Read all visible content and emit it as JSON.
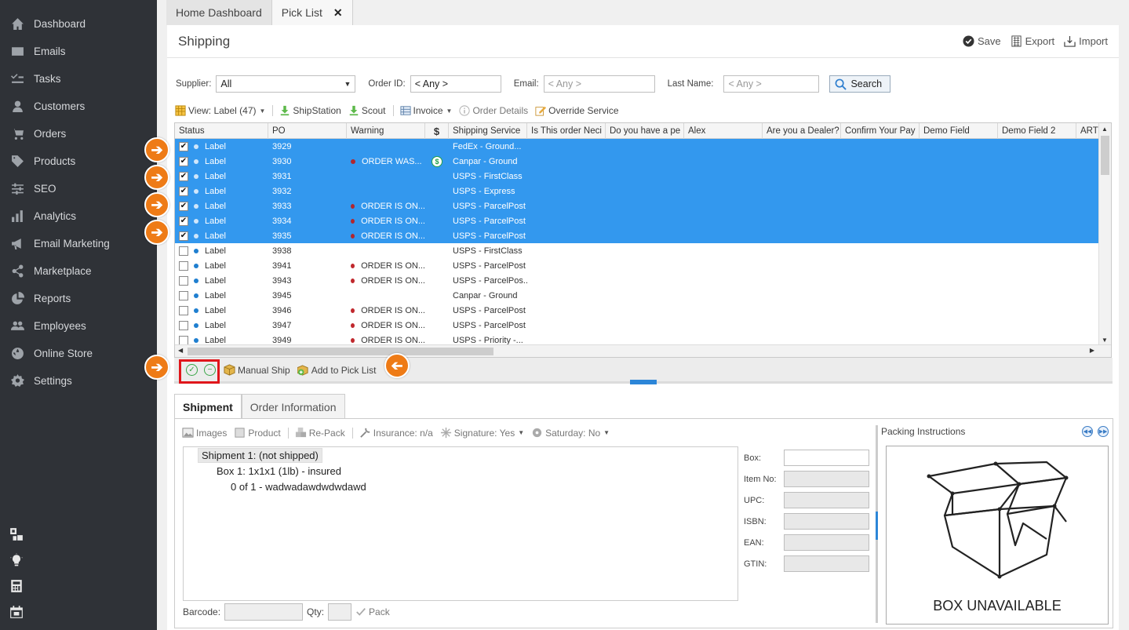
{
  "sidebar": {
    "items": [
      {
        "label": "Dashboard",
        "icon": "home-icon"
      },
      {
        "label": "Emails",
        "icon": "mail-icon"
      },
      {
        "label": "Tasks",
        "icon": "tasks-icon"
      },
      {
        "label": "Customers",
        "icon": "user-icon"
      },
      {
        "label": "Orders",
        "icon": "cart-icon"
      },
      {
        "label": "Products",
        "icon": "tag-icon"
      },
      {
        "label": "SEO",
        "icon": "sliders-icon"
      },
      {
        "label": "Analytics",
        "icon": "bar-chart-icon"
      },
      {
        "label": "Email Marketing",
        "icon": "megaphone-icon"
      },
      {
        "label": "Marketplace",
        "icon": "share-icon"
      },
      {
        "label": "Reports",
        "icon": "pie-chart-icon"
      },
      {
        "label": "Employees",
        "icon": "users-icon"
      },
      {
        "label": "Online Store",
        "icon": "globe-icon"
      },
      {
        "label": "Settings",
        "icon": "settings-icon"
      }
    ]
  },
  "tabs": [
    {
      "label": "Home Dashboard"
    },
    {
      "label": "Pick List",
      "close": "✕"
    }
  ],
  "header": {
    "title": "Shipping",
    "save": "Save",
    "export": "Export",
    "import": "Import"
  },
  "filters": {
    "supplier_label": "Supplier:",
    "supplier_value": "All",
    "orderid_label": "Order ID:",
    "orderid_value": "< Any >",
    "email_label": "Email:",
    "email_value": "< Any >",
    "lastname_label": "Last Name:",
    "lastname_value": "< Any >",
    "search": "Search"
  },
  "toolbar": {
    "view": "View: Label (47)",
    "shipstation": "ShipStation",
    "scout": "Scout",
    "invoice": "Invoice",
    "order_details": "Order Details",
    "override": "Override Service"
  },
  "grid": {
    "columns": [
      "Status",
      "PO",
      "Warning",
      "$",
      "Shipping Service",
      "Is This order Neci",
      "Do you have a pe",
      "Alex",
      "Are you a Dealer?",
      "Confirm Your Pay",
      "Demo Field",
      "Demo Field 2",
      "ARTH"
    ],
    "rows": [
      {
        "checked": "✔",
        "status": "Label",
        "po": "3929",
        "warning": "",
        "service": "FedEx - Ground..."
      },
      {
        "checked": "✔",
        "status": "Label",
        "po": "3930",
        "warning": "ORDER WAS...",
        "money": "$",
        "service": "Canpar - Ground"
      },
      {
        "checked": "✔",
        "status": "Label",
        "po": "3931",
        "warning": "",
        "service": "USPS - FirstClass"
      },
      {
        "checked": "✔",
        "status": "Label",
        "po": "3932",
        "warning": "",
        "service": "USPS - Express"
      },
      {
        "checked": "✔",
        "status": "Label",
        "po": "3933",
        "warning": "ORDER IS ON...",
        "service": "USPS - ParcelPost"
      },
      {
        "checked": "✔",
        "status": "Label",
        "po": "3934",
        "warning": "ORDER IS ON...",
        "service": "USPS - ParcelPost"
      },
      {
        "checked": "✔",
        "status": "Label",
        "po": "3935",
        "warning": "ORDER IS ON...",
        "service": "USPS - ParcelPost"
      },
      {
        "checked": "",
        "status": "Label",
        "po": "3938",
        "warning": "",
        "service": "USPS - FirstClass"
      },
      {
        "checked": "",
        "status": "Label",
        "po": "3941",
        "warning": "ORDER IS ON...",
        "service": "USPS - ParcelPost"
      },
      {
        "checked": "",
        "status": "Label",
        "po": "3943",
        "warning": "ORDER IS ON...",
        "service": "USPS - ParcelPos..."
      },
      {
        "checked": "",
        "status": "Label",
        "po": "3945",
        "warning": "",
        "service": "Canpar - Ground"
      },
      {
        "checked": "",
        "status": "Label",
        "po": "3946",
        "warning": "ORDER IS ON...",
        "service": "USPS - ParcelPost"
      },
      {
        "checked": "",
        "status": "Label",
        "po": "3947",
        "warning": "ORDER IS ON...",
        "service": "USPS - ParcelPost"
      },
      {
        "checked": "",
        "status": "Label",
        "po": "3949",
        "warning": "ORDER IS ON...",
        "service": "USPS - Priority -..."
      }
    ]
  },
  "bottom_bar": {
    "select_all": "✓",
    "deselect_all": "−",
    "manual_ship": "Manual Ship",
    "add_pick_list": "Add to Pick List"
  },
  "callouts": {
    "right": "➔",
    "left": "➔"
  },
  "shipment": {
    "tabs": [
      "Shipment",
      "Order Information"
    ],
    "toolbar": {
      "images": "Images",
      "product": "Product",
      "repack": "Re-Pack",
      "insurance": "Insurance: n/a",
      "signature": "Signature: Yes",
      "saturday": "Saturday: No"
    },
    "tree": {
      "shipment": "Shipment 1: (not shipped)",
      "box": "Box 1: 1x1x1 (1lb) - insured",
      "item": "0 of 1 - wadwadawdwdwdawd"
    },
    "fields": [
      "Box:",
      "Item No:",
      "UPC:",
      "ISBN:",
      "EAN:",
      "GTIN:"
    ],
    "barcode_label": "Barcode:",
    "qty_label": "Qty:",
    "pack": "Pack",
    "packing_title": "Packing Instructions",
    "box_unavailable": "BOX UNAVAILABLE"
  },
  "colors": {
    "sidebar": "#2f3237",
    "selected_row": "#3398ee",
    "callout": "#ee7b16",
    "highlight_box": "#e0161b",
    "warning_dot": "#c0282d"
  }
}
